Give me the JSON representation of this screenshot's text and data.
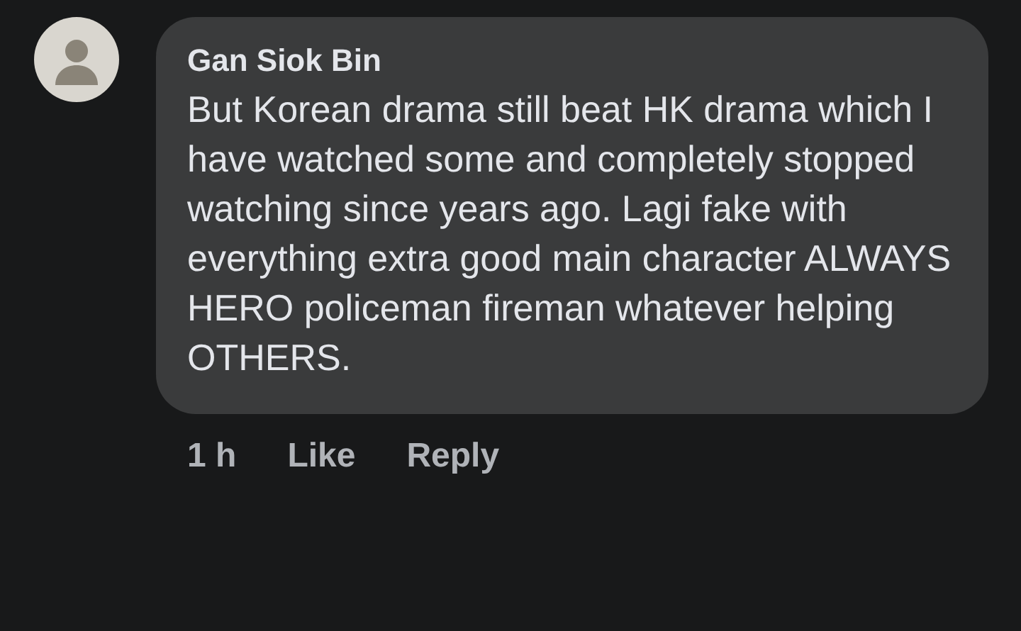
{
  "comment": {
    "author": "Gan Siok Bin",
    "text": "But Korean drama still beat HK drama which I have watched some and completely stopped watching since years ago. Lagi fake with everything extra good main character ALWAYS HERO policeman fireman whatever helping OTHERS.",
    "time": "1 h",
    "actions": [
      "Like",
      "Reply"
    ]
  }
}
